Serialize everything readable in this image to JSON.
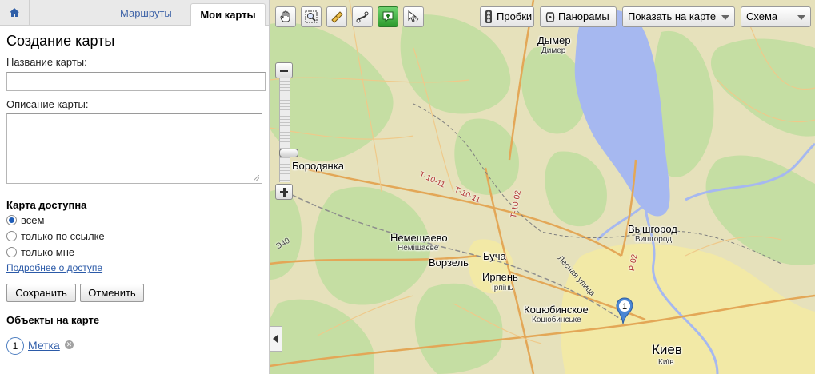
{
  "tabs": {
    "routes": "Маршруты",
    "my_maps": "Мои карты"
  },
  "form": {
    "title": "Создание карты",
    "name_label": "Название карты:",
    "name_value": "",
    "desc_label": "Описание карты:",
    "desc_value": "",
    "access_title": "Карта доступна",
    "access_options": [
      "всем",
      "только по ссылке",
      "только мне"
    ],
    "access_selected": "всем",
    "access_link": "Подробнее о доступе",
    "save": "Сохранить",
    "cancel": "Отменить"
  },
  "objects": {
    "title": "Объекты на карте",
    "items": [
      {
        "number": "1",
        "label": "Метка"
      }
    ]
  },
  "map": {
    "toolbar": {
      "traffic": "Пробки",
      "panoramas": "Панорамы",
      "show_on_map": "Показать на карте",
      "layer": "Схема"
    },
    "labels": {
      "dymer": "Дымер",
      "dymer_small": "Димер",
      "borodyanka": "Бородянка",
      "nemeshaevo": "Немешаево",
      "nemeshaevo_small": "Немішаєве",
      "vorzel": "Ворзель",
      "bucha": "Буча",
      "irpen": "Ирпень",
      "irpen_small": "Ірпінь",
      "kotsyubinskoe": "Коцюбинское",
      "kotsyubinskoe_small": "Коцюбинське",
      "vyshgorod": "Вышгород",
      "vyshgorod_small": "Вишгород",
      "kiev": "Киев",
      "kiev_small": "Київ",
      "lesnaya": "Лесная улица",
      "road_t1011a": "Т-10-11",
      "road_t1011b": "Т-10-11",
      "road_t1002": "Т-10-02",
      "road_r02": "Р-02",
      "road_zhitomir": "Э40"
    },
    "marker": "1",
    "colors": {
      "water": "#a6b8f0",
      "forest": "#c7dfa5",
      "land": "#e5e0b9",
      "road": "#e6b466"
    }
  }
}
